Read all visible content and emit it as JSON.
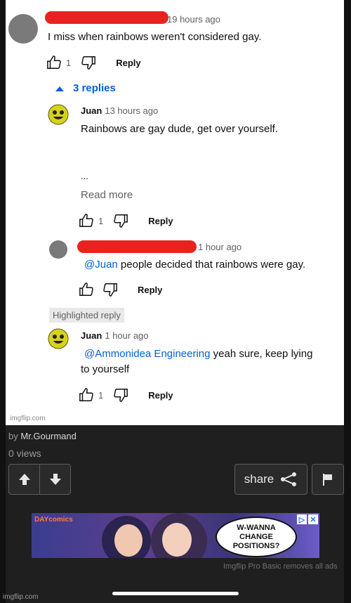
{
  "comments": [
    {
      "author": "",
      "time": "19 hours ago",
      "text": "I miss when rainbows weren't considered gay.",
      "likes": "1",
      "reply_label": "Reply"
    },
    {
      "author": "Juan",
      "time": "13 hours ago",
      "text": "Rainbows are gay dude, get over yourself.",
      "ellipsis": "...",
      "read_more": "Read more",
      "likes": "1",
      "reply_label": "Reply"
    },
    {
      "author": "",
      "time": "1 hour ago",
      "mention": "@Juan",
      "text": " people decided that rainbows were gay.",
      "reply_label": "Reply"
    },
    {
      "author": "Juan",
      "time": "1 hour ago",
      "mention": "@Ammonidea Engineering",
      "text_line1": " yeah sure, keep lying",
      "text_line2": "to yourself",
      "likes": "1",
      "reply_label": "Reply"
    }
  ],
  "replies_toggle": "3 replies",
  "highlighted_label": "Highlighted reply",
  "watermark": "imgflip.com",
  "post": {
    "by_prefix": "by",
    "author": "Mr.Gourmand",
    "views": "0 views",
    "share_label": "share"
  },
  "ad": {
    "brand": "DAYcomics",
    "bubble_line1": "W-WANNA",
    "bubble_line2": "CHANGE",
    "bubble_line3": "POSITIONS?",
    "pro_note": "Imgflip Pro Basic removes all ads"
  },
  "bottom_watermark": "imgflip.com",
  "colors": {
    "accent_link": "#065fd4",
    "redaction": "#e8231f",
    "page_bg": "#1f1f1f"
  }
}
